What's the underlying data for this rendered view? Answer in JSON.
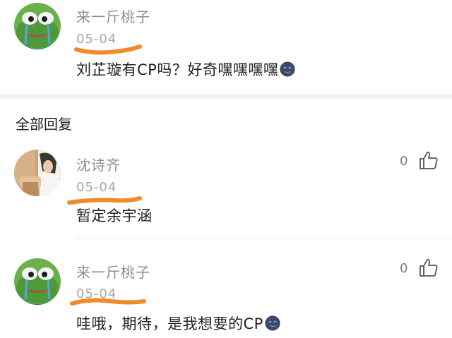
{
  "main_comment": {
    "username": "来一斤桃子",
    "date": "05-04",
    "text": "刘芷璇有CP吗？好奇嘿嘿嘿嘿",
    "emoji": "new-moon-face"
  },
  "replies_section": {
    "title": "全部回复"
  },
  "replies": [
    {
      "username": "沈诗齐",
      "date": "05-04",
      "text": "暂定余宇涵",
      "likes": "0"
    },
    {
      "username": "来一斤桃子",
      "date": "05-04",
      "text": "哇哦，期待，是我想要的CP",
      "emoji": "new-moon-face",
      "likes": "0"
    }
  ],
  "icons": {
    "like": "thumbs-up-icon",
    "emoji": "new-moon-face-icon"
  },
  "colors": {
    "highlight_mark": "#f08a2c",
    "username": "#8c8c8c",
    "text": "#222222"
  }
}
